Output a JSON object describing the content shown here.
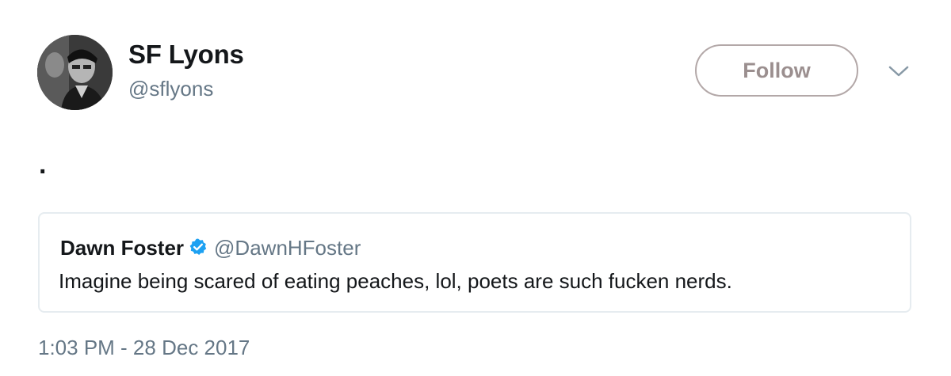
{
  "author": {
    "display_name": "SF Lyons",
    "handle": "@sflyons"
  },
  "follow_button": {
    "label": "Follow"
  },
  "menu": {
    "icon": "chevron-down-icon"
  },
  "tweet": {
    "text": "."
  },
  "quoted_tweet": {
    "display_name": "Dawn Foster",
    "verified_icon": "verified-badge-icon",
    "handle": "@DawnHFoster",
    "text": "Imagine being scared of eating peaches, lol, poets are such fucken nerds."
  },
  "timestamp": "1:03 PM - 28 Dec 2017",
  "colors": {
    "primary_text": "#14171a",
    "secondary_text": "#657786",
    "verified_blue": "#1da1f2",
    "border": "#e6ecf0",
    "follow_border": "#b3a8a8"
  }
}
